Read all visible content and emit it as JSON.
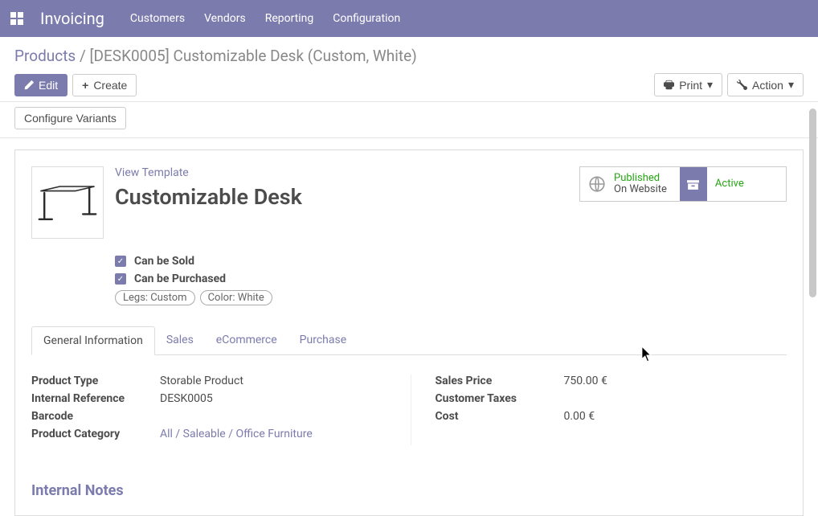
{
  "nav": {
    "brand": "Invoicing",
    "items": [
      "Customers",
      "Vendors",
      "Reporting",
      "Configuration"
    ]
  },
  "breadcrumb": {
    "root": "Products",
    "sep": " / ",
    "current": "[DESK0005] Customizable Desk (Custom, White)"
  },
  "buttons": {
    "edit": "Edit",
    "create": "Create",
    "print": "Print",
    "action": "Action",
    "configure_variants": "Configure Variants"
  },
  "header": {
    "view_template": "View Template",
    "title": "Customizable Desk"
  },
  "status": {
    "published": "Published",
    "on_website": "On Website",
    "active": "Active"
  },
  "checks": {
    "can_be_sold": "Can be Sold",
    "can_be_purchased": "Can be Purchased"
  },
  "tags": [
    "Legs: Custom",
    "Color: White"
  ],
  "tabs": [
    "General Information",
    "Sales",
    "eCommerce",
    "Purchase"
  ],
  "fields_left": {
    "product_type": {
      "label": "Product Type",
      "value": "Storable Product"
    },
    "internal_ref": {
      "label": "Internal Reference",
      "value": "DESK0005"
    },
    "barcode": {
      "label": "Barcode",
      "value": ""
    },
    "category": {
      "label": "Product Category",
      "value": "All / Saleable / Office Furniture"
    }
  },
  "fields_right": {
    "sales_price": {
      "label": "Sales Price",
      "value": "750.00 €"
    },
    "customer_taxes": {
      "label": "Customer Taxes",
      "value": ""
    },
    "cost": {
      "label": "Cost",
      "value": "0.00 €"
    }
  },
  "section": {
    "internal_notes": "Internal Notes"
  }
}
